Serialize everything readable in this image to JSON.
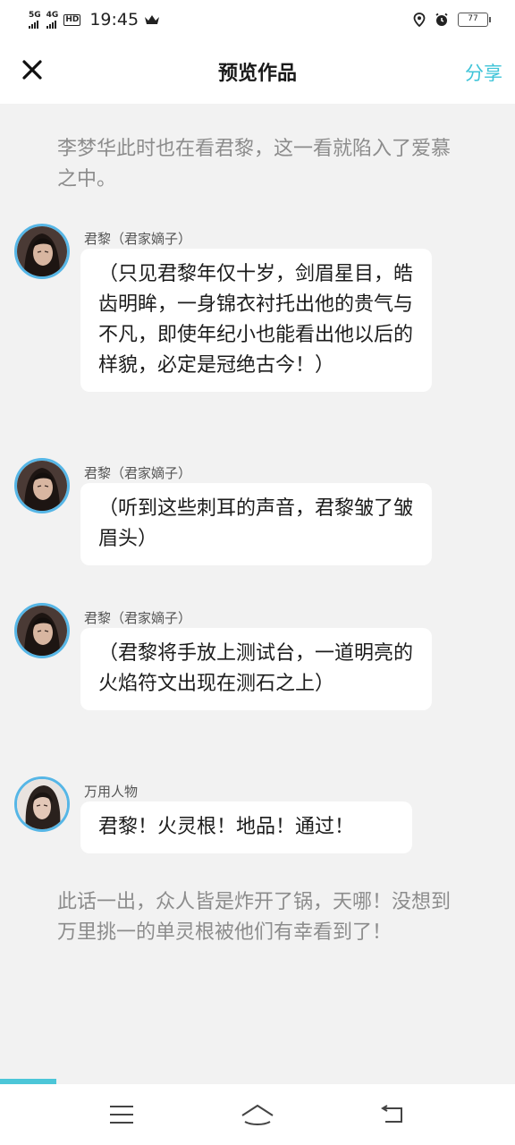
{
  "status_bar": {
    "net1": "5G",
    "net2": "4G",
    "hd": "HD",
    "time": "19:45",
    "battery": "77"
  },
  "header": {
    "title": "预览作品",
    "share_label": "分享"
  },
  "story": {
    "narration_top": "李梦华此时也在看君黎，这一看就陷入了爱慕之中。",
    "messages": [
      {
        "speaker": "君黎（君家嫡子）",
        "text": "（只见君黎年仅十岁，剑眉星目，皓齿明眸，一身锦衣衬托出他的贵气与不凡，即使年纪小也能看出他以后的样貌，必定是冠绝古今！）"
      },
      {
        "speaker": "君黎（君家嫡子）",
        "text": "（听到这些刺耳的声音，君黎皱了皱眉头）"
      },
      {
        "speaker": "君黎（君家嫡子）",
        "text": "（君黎将手放上测试台，一道明亮的火焰符文出现在测石之上）"
      },
      {
        "speaker": "万用人物",
        "text": "君黎！火灵根！地品！通过！"
      }
    ],
    "narration_bottom": "此话一出，众人皆是炸开了锅，天哪！没想到万里挑一的单灵根被他们有幸看到了！"
  },
  "colors": {
    "accent": "#3fc4d8",
    "avatar_ring": "#56b6e6",
    "narration": "#8c8c8c",
    "background": "#f2f2f2"
  },
  "reading_progress": 0.11
}
